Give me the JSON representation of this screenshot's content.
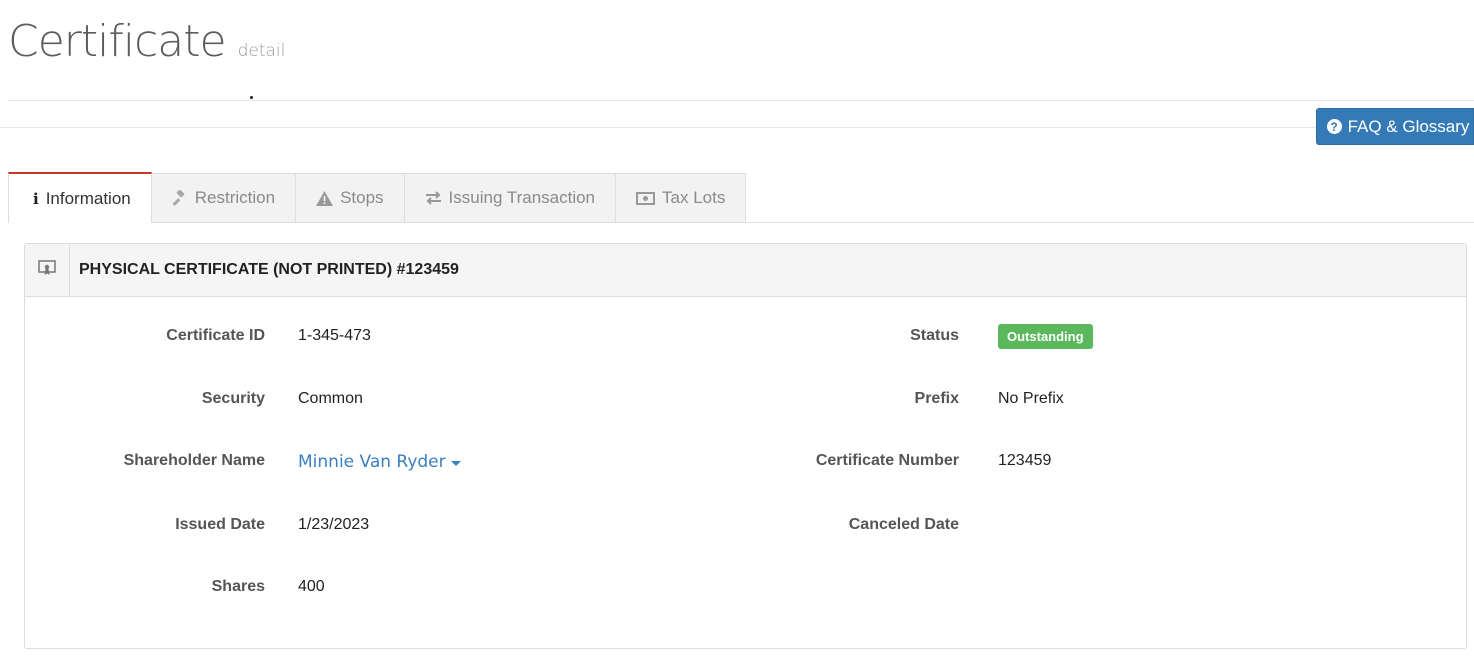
{
  "header": {
    "title": "Certificate",
    "subtitle": "detail"
  },
  "faq_button": {
    "label": "FAQ & Glossary",
    "icon": "question-circle-icon"
  },
  "tabs": [
    {
      "label": "Information",
      "icon": "info-icon",
      "active": true
    },
    {
      "label": "Restriction",
      "icon": "gavel-icon",
      "active": false
    },
    {
      "label": "Stops",
      "icon": "warning-icon",
      "active": false
    },
    {
      "label": "Issuing Transaction",
      "icon": "exchange-icon",
      "active": false
    },
    {
      "label": "Tax Lots",
      "icon": "money-icon",
      "active": false
    }
  ],
  "panel": {
    "title": "PHYSICAL CERTIFICATE (NOT PRINTED) #123459",
    "icon": "certificate-icon",
    "left_fields": [
      {
        "label": "Certificate ID",
        "value": "1-345-473"
      },
      {
        "label": "Security",
        "value": "Common"
      },
      {
        "label": "Shareholder Name",
        "value": "Minnie Van Ryder"
      },
      {
        "label": "Issued Date",
        "value": "1/23/2023"
      },
      {
        "label": "Shares",
        "value": "400"
      }
    ],
    "right_fields": [
      {
        "label": "Status",
        "value": "Outstanding"
      },
      {
        "label": "Prefix",
        "value": "No Prefix"
      },
      {
        "label": "Certificate Number",
        "value": "123459"
      },
      {
        "label": "Canceled Date",
        "value": ""
      }
    ]
  },
  "colors": {
    "accent": "#337ab7",
    "status_badge": "#5cb85c",
    "active_tab_border": "#c0392b",
    "link": "#3a7fc1"
  }
}
